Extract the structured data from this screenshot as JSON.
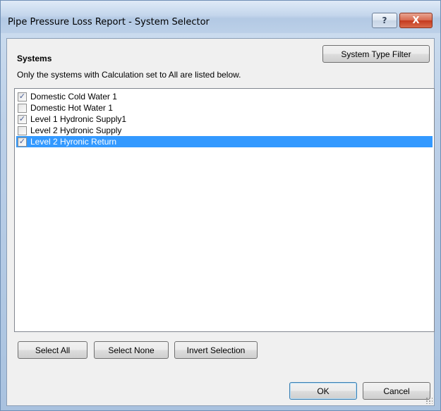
{
  "window": {
    "title": "Pipe Pressure Loss Report - System Selector",
    "help_glyph": "?",
    "close_glyph": "X"
  },
  "dialog": {
    "heading": "Systems",
    "system_type_filter_label": "System Type Filter",
    "description": "Only the systems with Calculation set to All are listed below.",
    "systems": [
      {
        "label": "Domestic Cold Water 1",
        "checked": true,
        "selected": false
      },
      {
        "label": "Domestic Hot Water 1",
        "checked": false,
        "selected": false
      },
      {
        "label": "Level 1 Hydronic Supply1",
        "checked": true,
        "selected": false
      },
      {
        "label": "Level 2 Hydronic Supply",
        "checked": false,
        "selected": false
      },
      {
        "label": "Level 2 Hyronic Return",
        "checked": true,
        "selected": true
      }
    ],
    "select_all_label": "Select All",
    "select_none_label": "Select None",
    "invert_selection_label": "Invert Selection",
    "ok_label": "OK",
    "cancel_label": "Cancel"
  },
  "colors": {
    "selection": "#3399ff",
    "close_button": "#c4391e"
  }
}
